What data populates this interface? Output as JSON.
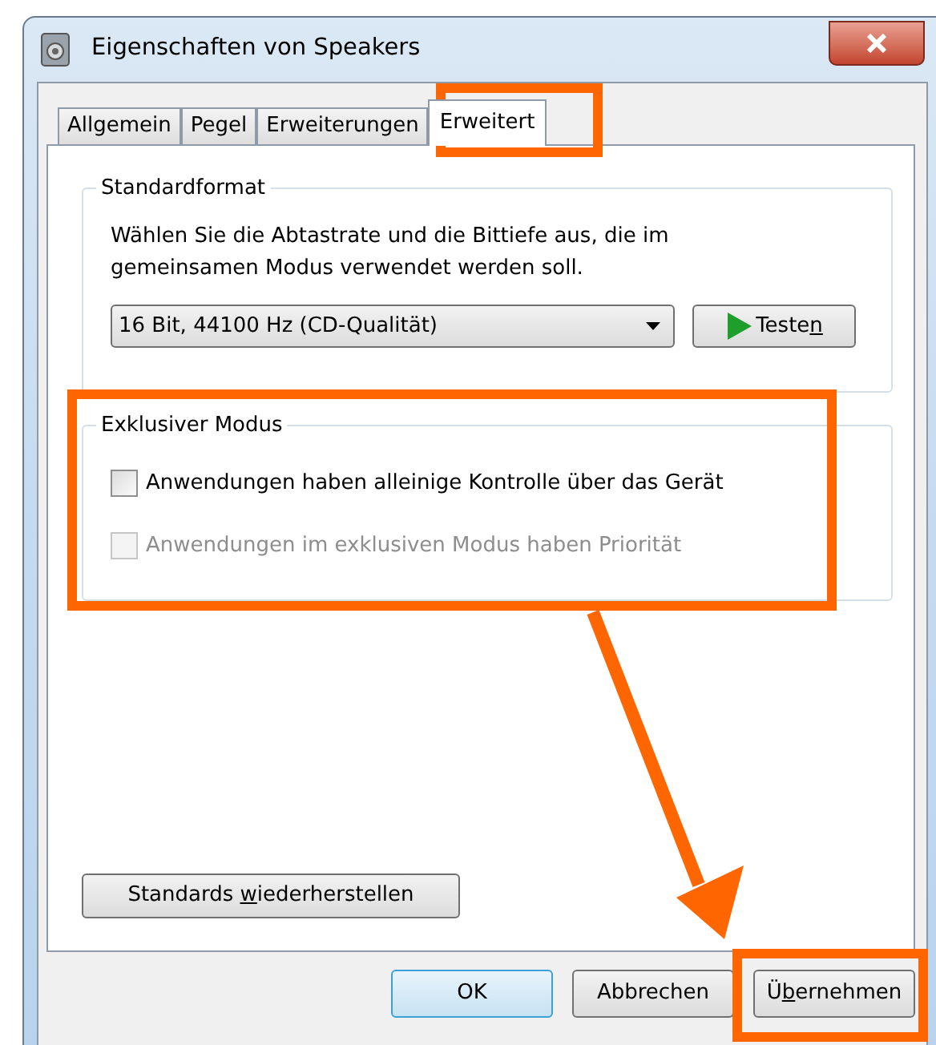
{
  "window": {
    "title": "Eigenschaften von Speakers"
  },
  "tabs": [
    {
      "label": "Allgemein",
      "selected": false
    },
    {
      "label": "Pegel",
      "selected": false
    },
    {
      "label": "Erweiterungen",
      "selected": false
    },
    {
      "label": "Erweitert",
      "selected": true
    }
  ],
  "default_format": {
    "title": "Standardformat",
    "description": "Wählen Sie die Abtastrate und die Bittiefe aus, die im gemeinsamen Modus verwendet werden soll.",
    "format_dropdown": {
      "value": "16 Bit, 44100 Hz (CD-Qualität)"
    },
    "test_button": {
      "label_before": "Teste",
      "access_key": "n"
    }
  },
  "exclusive_mode": {
    "title": "Exklusiver Modus",
    "options": [
      {
        "label": "Anwendungen haben alleinige Kontrolle über das Gerät",
        "checked": false,
        "disabled": false
      },
      {
        "label": "Anwendungen im exklusiven Modus haben Priorität",
        "checked": false,
        "disabled": true
      }
    ]
  },
  "restore_button": {
    "label_before": "Standards ",
    "access_key": "w",
    "label_after": "iederherstellen"
  },
  "dialog_buttons": [
    {
      "label_before": "OK",
      "default": true
    },
    {
      "label_before": "Abbrechen",
      "default": false
    },
    {
      "label_before": "Ü",
      "access_key": "b",
      "label_after": "ernehmen",
      "default": false
    }
  ]
}
